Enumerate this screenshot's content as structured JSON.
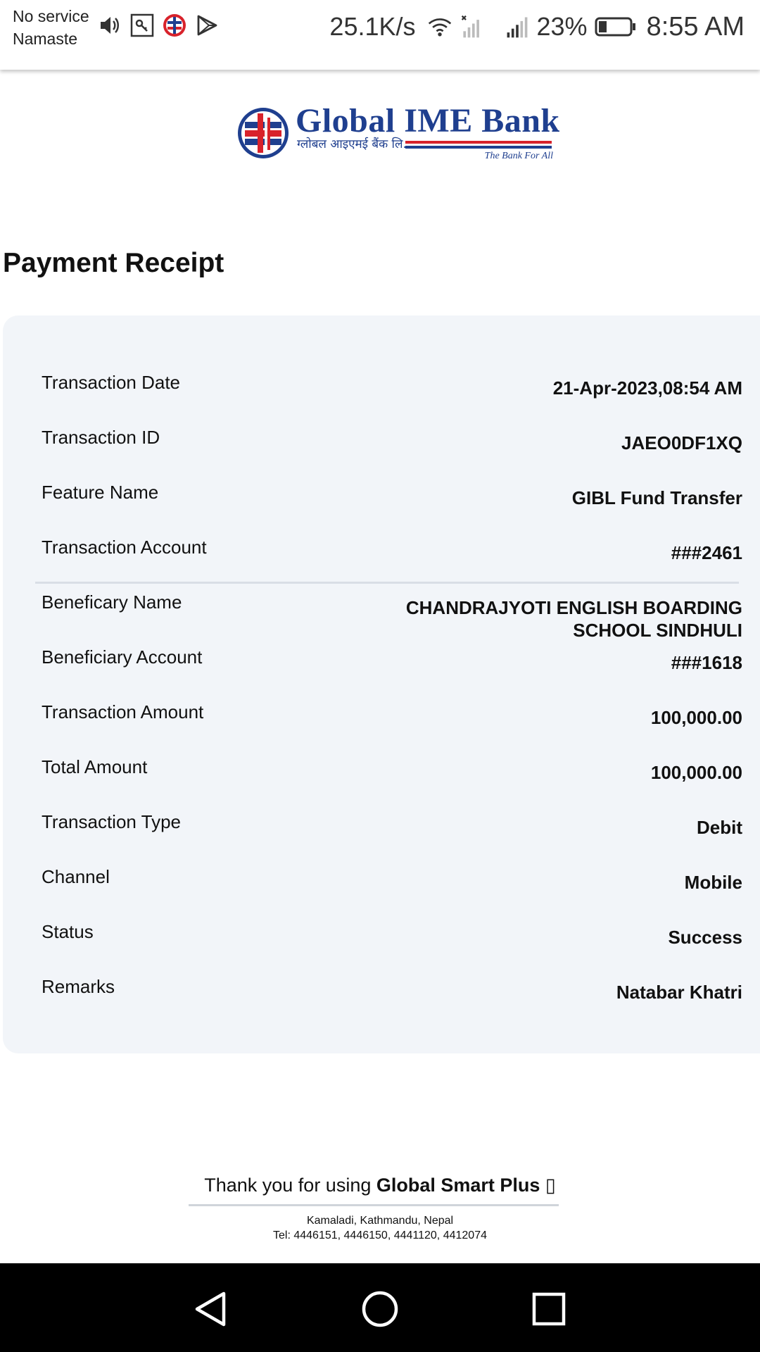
{
  "status_bar": {
    "carrier_line1": "No service",
    "carrier_line2": "Namaste",
    "net_speed": "25.1K/s",
    "battery_percent": "23%",
    "time": "8:55 AM",
    "icons": [
      "volume-icon",
      "key-icon",
      "bank-app-icon",
      "play-store-icon",
      "wifi-icon",
      "signal-no-service-icon",
      "signal-icon",
      "battery-icon"
    ]
  },
  "logo": {
    "name": "Global IME Bank",
    "subtitle": "ग्लोबल आइएमई बैंक लि.",
    "tagline": "The Bank For All",
    "colors": {
      "blue": "#1f3f8f",
      "red": "#d8222b"
    }
  },
  "page": {
    "title": "Payment Receipt"
  },
  "receipt": [
    {
      "label": "Transaction Date",
      "value": "21-Apr-2023,08:54 AM"
    },
    {
      "label": "Transaction ID",
      "value": "JAEO0DF1XQ"
    },
    {
      "label": "Feature Name",
      "value": "GIBL Fund Transfer"
    },
    {
      "label": "Transaction Account",
      "value": "###2461"
    },
    {
      "label": "Beneficary Name",
      "value": "CHANDRAJYOTI ENGLISH BOARDING\nSCHOOL SINDHULI"
    },
    {
      "label": "Beneficiary Account",
      "value": "###1618"
    },
    {
      "label": "Transaction Amount",
      "value": "100,000.00"
    },
    {
      "label": "Total Amount",
      "value": "100,000.00"
    },
    {
      "label": "Transaction Type",
      "value": "Debit"
    },
    {
      "label": "Channel",
      "value": "Mobile"
    },
    {
      "label": "Status",
      "value": "Success"
    },
    {
      "label": "Remarks",
      "value": "Natabar Khatri"
    }
  ],
  "footer": {
    "thanks_prefix": "Thank you for using ",
    "thanks_brand": "Global Smart Plus",
    "thanks_suffix": " ▯",
    "address": "Kamaladi, Kathmandu, Nepal",
    "phone": "Tel: 4446151, 4446150, 4441120, 4412074"
  },
  "nav_bar": {
    "buttons": [
      "back-icon",
      "home-icon",
      "recents-icon"
    ]
  }
}
